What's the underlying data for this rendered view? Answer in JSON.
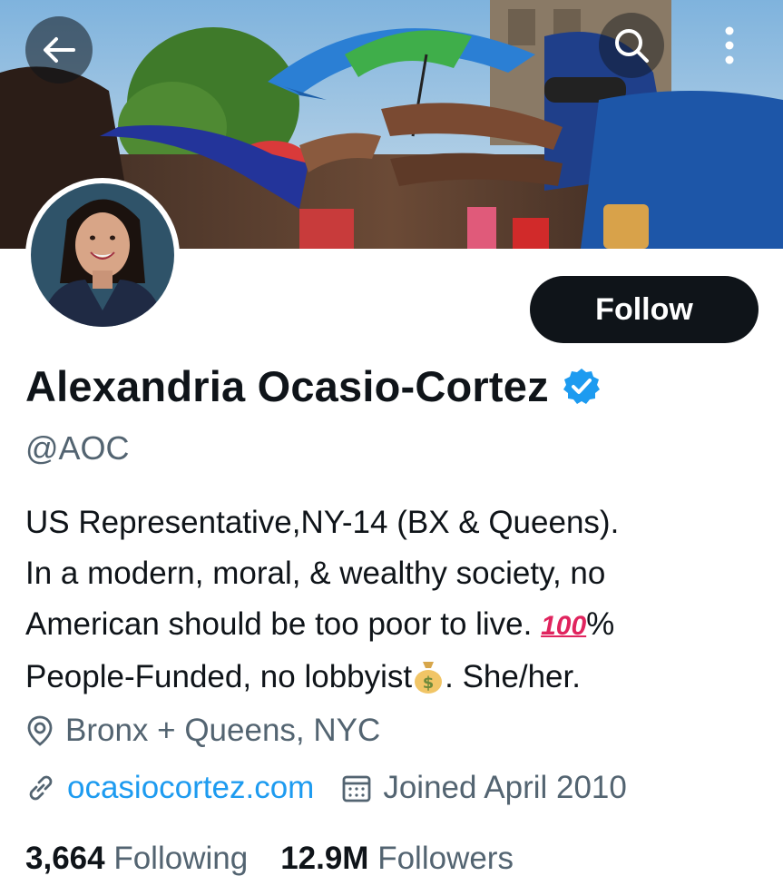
{
  "header": {
    "back_icon": "arrow-left-icon",
    "search_icon": "search-icon",
    "more_icon": "more-vertical-icon"
  },
  "profile": {
    "display_name": "Alexandria Ocasio-Cortez",
    "verified": true,
    "handle": "@AOC",
    "follow_label": "Follow",
    "bio": {
      "line1": "US Representative,NY-14 (BX & Queens).",
      "line2": "In a modern, moral, & wealthy society, no",
      "line3_text": "American should be too poor to live. ",
      "line3_emoji": "100",
      "line3_suffix": "%",
      "line4_text": "People-Funded, no lobbyist",
      "line4_suffix": ". She/her."
    },
    "location": "Bronx + Queens, NYC",
    "website": "ocasiocortez.com",
    "joined": "Joined April 2010",
    "following_count": "3,664",
    "following_label": "Following",
    "followers_count": "12.9M",
    "followers_label": "Followers"
  },
  "colors": {
    "accent": "#1d9bf0",
    "text_primary": "#0f1419",
    "text_secondary": "#536471",
    "button_bg": "#0f1419"
  }
}
